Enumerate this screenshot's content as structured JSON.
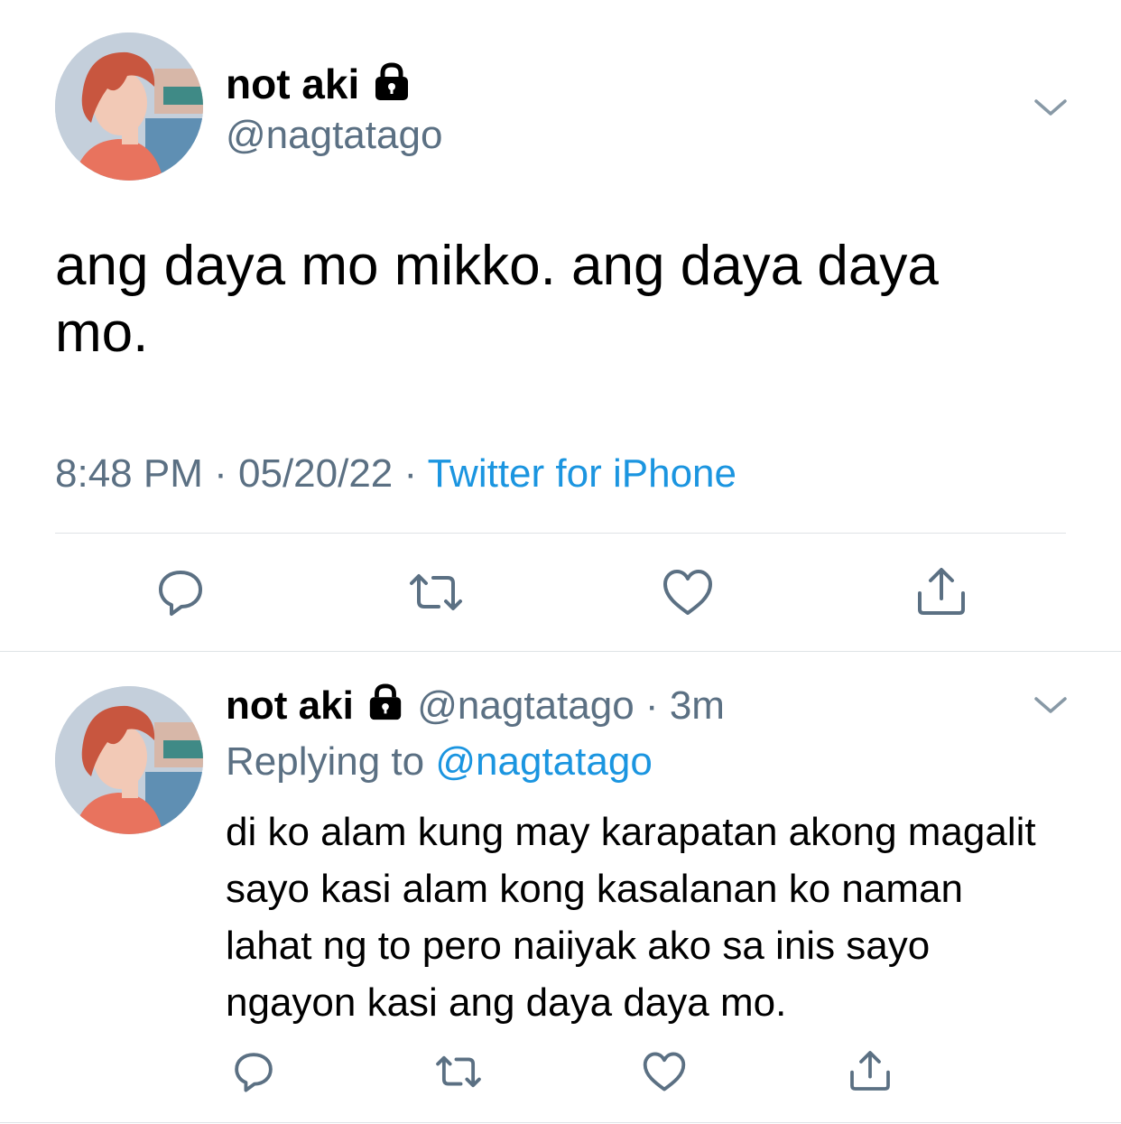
{
  "main_tweet": {
    "author": {
      "name": "not aki",
      "handle": "@nagtatago"
    },
    "text": "ang daya mo mikko. ang daya daya mo.",
    "time": "8:48 PM",
    "date": "05/20/22",
    "source": "Twitter for iPhone",
    "separator": "·"
  },
  "reply_tweet": {
    "author": {
      "name": "not aki",
      "handle": "@nagtatago"
    },
    "separator": "·",
    "age": "3m",
    "replying_label": "Replying to",
    "replying_to": "@nagtatago",
    "text": "di ko alam kung may karapatan akong magalit sayo kasi alam kong kasalanan ko naman lahat ng to pero naiiyak ako sa inis sayo ngayon kasi ang daya daya mo."
  },
  "colors": {
    "text": "#000000",
    "secondary": "#5b7083",
    "link": "#1b95e0",
    "divider": "#dfe3e6",
    "icon": "#5b7083"
  },
  "icons": {
    "lock": "lock-icon",
    "menu": "chevron-down-icon",
    "reply": "reply-icon",
    "retweet": "retweet-icon",
    "like": "heart-icon",
    "share": "share-icon"
  }
}
